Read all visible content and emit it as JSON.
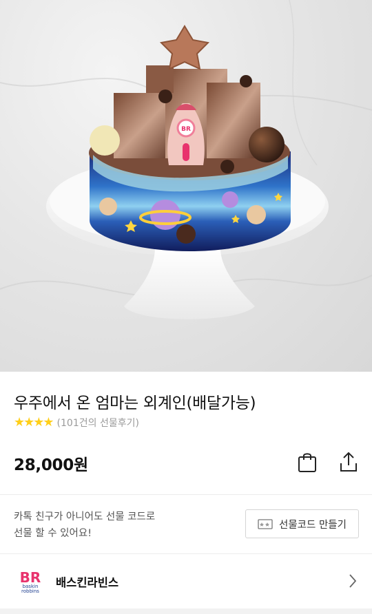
{
  "product": {
    "title": "우주에서 온 엄마는 외계인(배달가능)",
    "stars": "★★★★",
    "review_text": "(101건의 선물후기)",
    "price": "28,000원"
  },
  "image": {
    "logo_text": "BR"
  },
  "gift": {
    "note_line1": "카톡 친구가 아니어도 선물 코드로",
    "note_line2": "선물 할 수 있어요!",
    "button_label": "선물코드 만들기"
  },
  "brand": {
    "name": "배스킨라빈스",
    "logo_mark": "BR",
    "logo_word1": "baskin",
    "logo_word2": "robbins"
  },
  "icons": {
    "bag": "shopping-bag-icon",
    "share": "share-icon",
    "giftcode": "ticket-icon",
    "chevron": "chevron-right-icon"
  },
  "colors": {
    "star": "#ffcf1a",
    "brand_pink": "#e8336d",
    "brand_blue": "#1d3d8f"
  }
}
